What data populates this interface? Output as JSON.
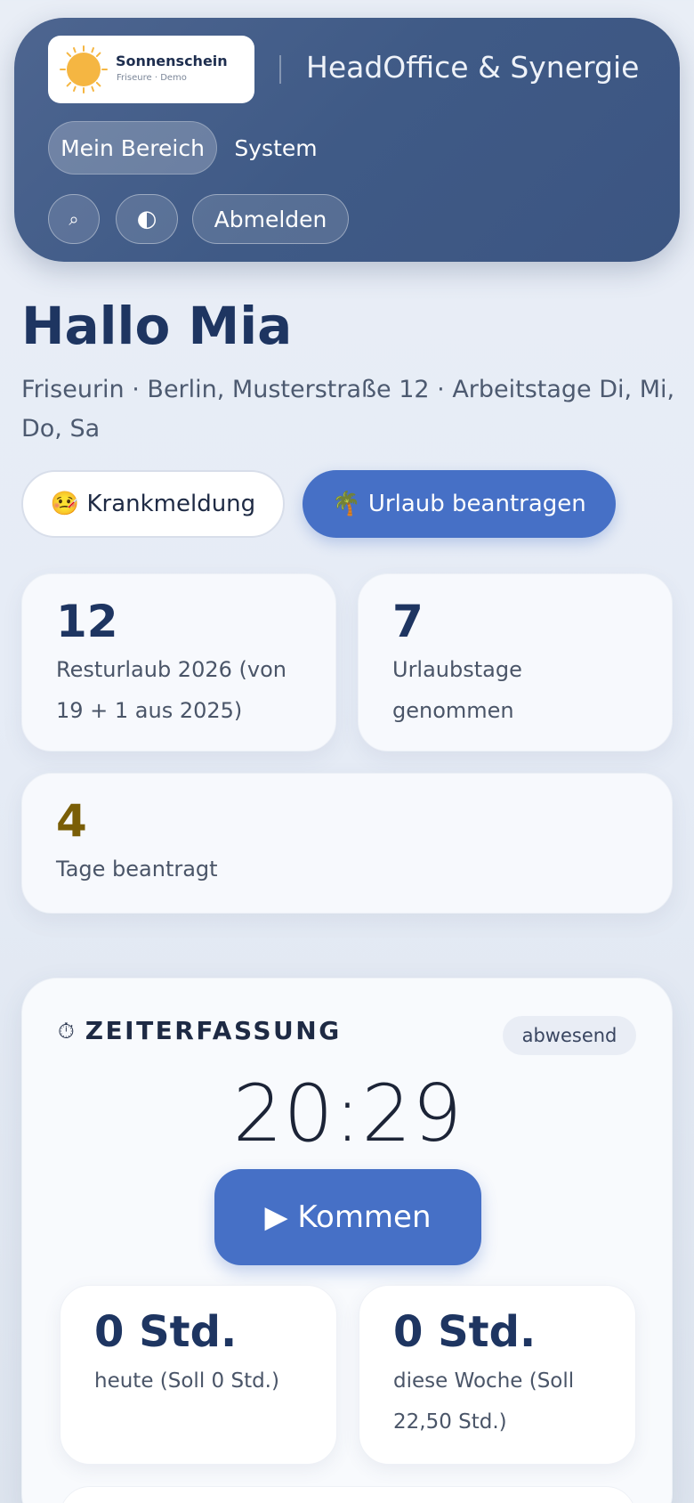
{
  "header": {
    "logo": {
      "name": "Sonnenschein",
      "subtitle": "Friseure · Demo"
    },
    "title": "HeadOffice & Synergie",
    "nav": [
      {
        "label": "Mein Bereich",
        "active": true
      },
      {
        "label": "System",
        "active": false
      }
    ],
    "tools": {
      "search_icon": "⌕",
      "theme_icon": "◐",
      "logout_label": "Abmelden"
    }
  },
  "greeting": {
    "title": "Hallo Mia",
    "subtitle": "Friseurin · Berlin, Musterstraße 12 · Arbeitstage Di, Mi, Do, Sa"
  },
  "actions": {
    "sick_label": "🤒 Krankmeldung",
    "vacation_label": "🌴 Urlaub beantragen"
  },
  "stats": [
    {
      "value": "12",
      "label": "Resturlaub 2026 (von 19 + 1 aus 2025)"
    },
    {
      "value": "7",
      "label": "Urlaubstage genommen"
    },
    {
      "value": "4",
      "label": "Tage beantragt"
    }
  ],
  "time_tracking": {
    "icon": "⏱",
    "title": "ZEITERFASSUNG",
    "status": "abwesend",
    "clock": "20:29",
    "come_label": "▶ Kommen",
    "summary": [
      {
        "value": "0 Std.",
        "label": "heute (Soll 0 Std.)"
      },
      {
        "value": "0 Std.",
        "label": "diese Woche (Soll 22,50 Std.)"
      }
    ]
  },
  "colors": {
    "header_bg": "#44608c",
    "primary": "#4670c6",
    "heading": "#1e3561",
    "requested": "#7a5e07",
    "logo_sun": "#f5b642"
  }
}
